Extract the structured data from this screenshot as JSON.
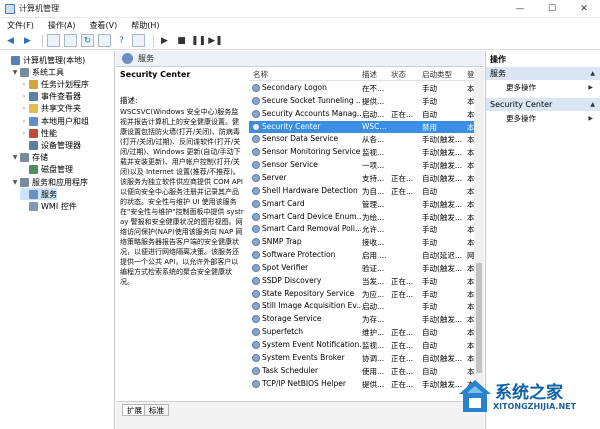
{
  "window": {
    "title": "计算机管理",
    "min": "—",
    "max": "☐",
    "close": "✕"
  },
  "menu": [
    "文件(F)",
    "操作(A)",
    "查看(V)",
    "帮助(H)"
  ],
  "tree": [
    {
      "label": "计算机管理(本地)",
      "level": 0,
      "expander": "",
      "color": "#5a7fb0"
    },
    {
      "label": "系统工具",
      "level": 1,
      "expander": "▼",
      "color": "#7a8b9c"
    },
    {
      "label": "任务计划程序",
      "level": 2,
      "expander": "›",
      "color": "#d6a33a"
    },
    {
      "label": "事件查看器",
      "level": 2,
      "expander": "›",
      "color": "#5b7fa5"
    },
    {
      "label": "共享文件夹",
      "level": 2,
      "expander": "›",
      "color": "#e3bc4e"
    },
    {
      "label": "本地用户和组",
      "level": 2,
      "expander": "›",
      "color": "#5f8ec8"
    },
    {
      "label": "性能",
      "level": 2,
      "expander": "›",
      "color": "#c24b3a"
    },
    {
      "label": "设备管理器",
      "level": 2,
      "expander": "",
      "color": "#5f7d9f"
    },
    {
      "label": "存储",
      "level": 1,
      "expander": "▼",
      "color": "#7a8b9c"
    },
    {
      "label": "磁盘管理",
      "level": 2,
      "expander": "",
      "color": "#4d8f5b"
    },
    {
      "label": "服务和应用程序",
      "level": 1,
      "expander": "▼",
      "color": "#7a8b9c"
    },
    {
      "label": "服务",
      "level": 2,
      "expander": "",
      "color": "#6c8fbf",
      "selected": true
    },
    {
      "label": "WMI 控件",
      "level": 2,
      "expander": "",
      "color": "#7d98b8"
    }
  ],
  "middle_header": "服务",
  "detail": {
    "service_name": "Security Center",
    "desc_label": "描述:",
    "description": "WSCSVC(Windows 安全中心)服务监视并报告计算机上的安全健康设置。健康设置包括防火墙(打开/关闭)、防病毒(打开/关闭/过期)、反间谍软件(打开/关闭/过期)、Windows 更新(自动/手动下载并安装更新)、用户帐户控制(打开/关闭)以及 Internet 设置(推荐/不推荐)。该服务为独立软件供应商提供 COM API 以便向安全中心服务注册并记录其产品的状态。安全性与维护 UI 使用该服务在\"安全性与维护\"控制面板中提供 systray 警报和安全健康状况的图形视图。网络访问保护(NAP)使用该服务向 NAP 网络策略服务器报告客户端的安全健康状况，以便进行网络隔离决策。该服务还提供一个公共 API，以允许外部客户以编程方式检索系统的聚合安全健康状况。"
  },
  "columns": {
    "name": "名称",
    "desc": "描述",
    "status": "状态",
    "startup": "启动类型",
    "logon": "登"
  },
  "services": [
    {
      "name": "Secondary Logon",
      "desc": "在不...",
      "status": "",
      "startup": "手动",
      "logon": "本"
    },
    {
      "name": "Secure Socket Tunneling ...",
      "desc": "提供...",
      "status": "",
      "startup": "手动",
      "logon": "本"
    },
    {
      "name": "Security Accounts Manag...",
      "desc": "启动...",
      "status": "正在...",
      "startup": "自动",
      "logon": "本"
    },
    {
      "name": "Security Center",
      "desc": "WSC...",
      "status": "",
      "startup": "禁用",
      "logon": "本",
      "selected": true
    },
    {
      "name": "Sensor Data Service",
      "desc": "从各...",
      "status": "",
      "startup": "手动(触发...",
      "logon": "本"
    },
    {
      "name": "Sensor Monitoring Service",
      "desc": "监视...",
      "status": "",
      "startup": "手动(触发...",
      "logon": "本"
    },
    {
      "name": "Sensor Service",
      "desc": "一项...",
      "status": "",
      "startup": "手动(触发...",
      "logon": "本"
    },
    {
      "name": "Server",
      "desc": "支持...",
      "status": "正在...",
      "startup": "自动(触发...",
      "logon": "本"
    },
    {
      "name": "Shell Hardware Detection",
      "desc": "为自...",
      "status": "正在...",
      "startup": "自动",
      "logon": "本"
    },
    {
      "name": "Smart Card",
      "desc": "管理...",
      "status": "",
      "startup": "手动(触发...",
      "logon": "本"
    },
    {
      "name": "Smart Card Device Enum...",
      "desc": "为绘...",
      "status": "",
      "startup": "手动(触发...",
      "logon": "本"
    },
    {
      "name": "Smart Card Removal Poli...",
      "desc": "允许...",
      "status": "",
      "startup": "手动",
      "logon": "本"
    },
    {
      "name": "SNMP Trap",
      "desc": "接收...",
      "status": "",
      "startup": "手动",
      "logon": "本"
    },
    {
      "name": "Software Protection",
      "desc": "启用 ...",
      "status": "",
      "startup": "自动(延迟...",
      "logon": "网"
    },
    {
      "name": "Spot Verifier",
      "desc": "验证...",
      "status": "",
      "startup": "手动(触发...",
      "logon": "本"
    },
    {
      "name": "SSDP Discovery",
      "desc": "当发...",
      "status": "正在...",
      "startup": "手动",
      "logon": "本"
    },
    {
      "name": "State Repository Service",
      "desc": "为应...",
      "status": "正在...",
      "startup": "手动",
      "logon": "本"
    },
    {
      "name": "Still Image Acquisition Ev...",
      "desc": "启动...",
      "status": "",
      "startup": "手动",
      "logon": "本"
    },
    {
      "name": "Storage Service",
      "desc": "为存...",
      "status": "",
      "startup": "手动(触发...",
      "logon": "本"
    },
    {
      "name": "Superfetch",
      "desc": "维护...",
      "status": "正在...",
      "startup": "自动",
      "logon": "本"
    },
    {
      "name": "System Event Notification...",
      "desc": "监视...",
      "status": "正在...",
      "startup": "自动",
      "logon": "本"
    },
    {
      "name": "System Events Broker",
      "desc": "协调...",
      "status": "正在...",
      "startup": "自动(触发...",
      "logon": "本"
    },
    {
      "name": "Task Scheduler",
      "desc": "使用...",
      "status": "正在...",
      "startup": "自动",
      "logon": "本"
    },
    {
      "name": "TCP/IP NetBIOS Helper",
      "desc": "提供...",
      "status": "正在...",
      "startup": "手动(触发...",
      "logon": "本"
    }
  ],
  "tabs": {
    "extended": "扩展",
    "standard": "标准"
  },
  "actions": {
    "title": "操作",
    "group1": "服务",
    "more1": "更多操作",
    "group2": "Security Center",
    "more2": "更多操作",
    "caret_up": "▲",
    "caret_right": "▶"
  },
  "watermark": {
    "brand": "系统之家",
    "url": "XITONGZHIJIA.NET"
  }
}
